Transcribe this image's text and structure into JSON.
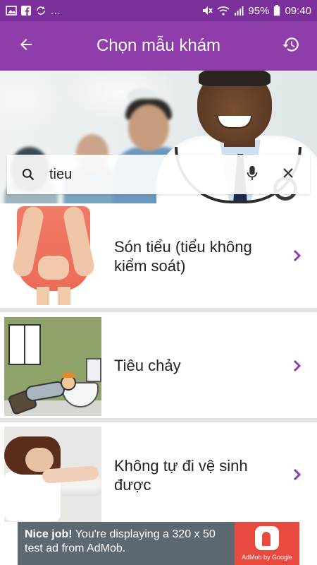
{
  "status_bar": {
    "dots": "...",
    "battery_percent": "95%",
    "time": "09:40"
  },
  "app_bar": {
    "title": "Chọn mẫu khám"
  },
  "search": {
    "value": "tieu"
  },
  "results": [
    {
      "label": "Són tiểu (tiểu không kiểm soát)"
    },
    {
      "label": "Tiêu chảy"
    },
    {
      "label": "Không tự đi vệ sinh được"
    }
  ],
  "ad": {
    "headline": "Nice job!",
    "body": " You're displaying a 320 x 50 test ad from AdMob.",
    "caption": "AdMob by Google"
  },
  "colors": {
    "status_bar": "#7a2f9a",
    "app_bar": "#8e3dab",
    "chevron": "#8e3dab",
    "ad_background": "#5d6972",
    "ad_logo": "#e94a3f"
  },
  "icons": {
    "status_left": [
      "gallery-icon",
      "facebook-icon",
      "sync-icon"
    ],
    "status_right": [
      "mute-icon",
      "wifi-icon",
      "signal-icon",
      "battery-icon"
    ],
    "app_bar": [
      "back-arrow-icon",
      "history-icon"
    ],
    "search": [
      "search-icon",
      "microphone-icon",
      "close-icon"
    ],
    "list": "chevron-right-icon"
  }
}
